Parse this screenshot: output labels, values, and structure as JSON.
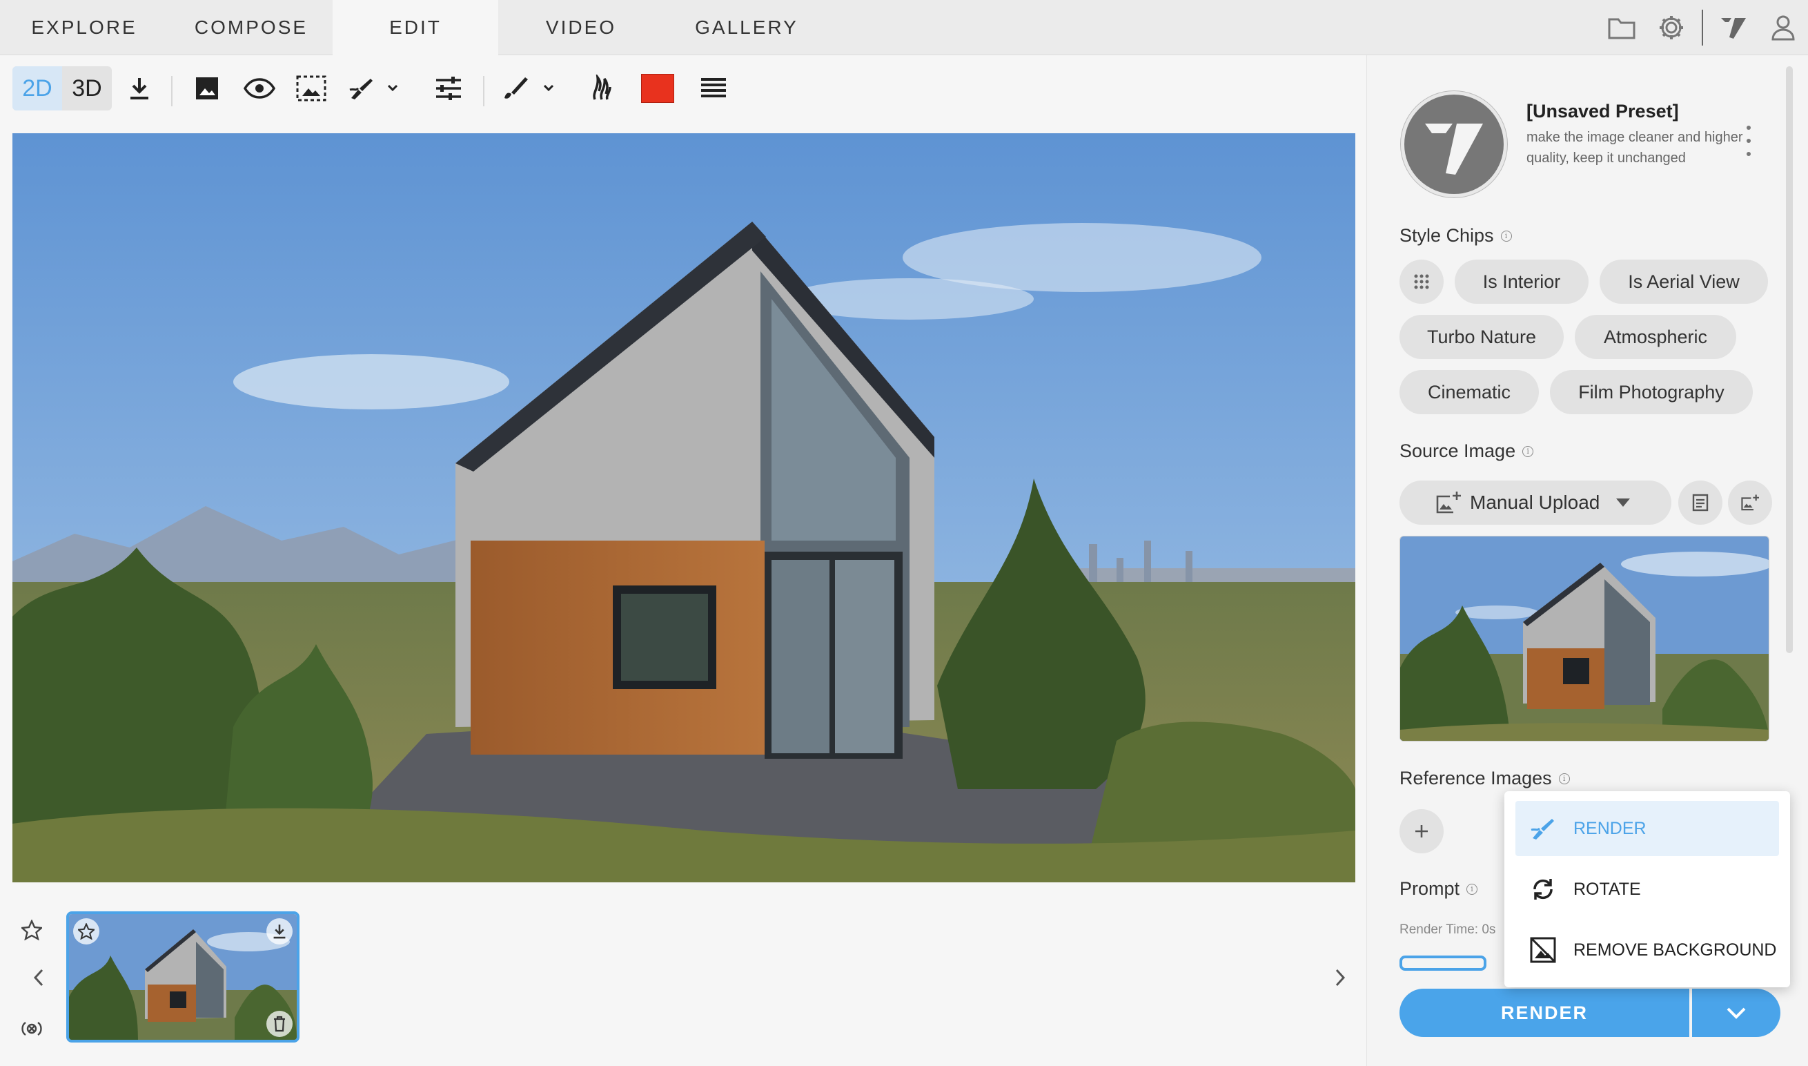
{
  "nav": {
    "tabs": [
      {
        "label": "EXPLORE"
      },
      {
        "label": "COMPOSE"
      },
      {
        "label": "EDIT",
        "active": true
      },
      {
        "label": "VIDEO"
      },
      {
        "label": "GALLERY"
      }
    ],
    "right_icons": [
      "folder-icon",
      "gear-icon",
      "brand-logo-icon",
      "user-icon"
    ]
  },
  "toolbar": {
    "dim_2d": "2D",
    "dim_3d": "3D",
    "active_dim": "2D",
    "icons": [
      "download-icon",
      "image-icon",
      "eye-icon",
      "select-region-icon",
      "brush-mask-icon",
      "sliders-icon",
      "paint-brush-icon",
      "flame-icon",
      "color-swatch",
      "menu-lines-icon"
    ],
    "color": "#e8321e"
  },
  "canvas": {
    "image": "house-on-moor-photo"
  },
  "strip": {
    "icons": [
      "star-icon",
      "chevron-left-icon",
      "no-eye-icon",
      "chevron-right-icon"
    ],
    "thumb_icons": [
      "star-icon",
      "download-icon",
      "trash-icon"
    ]
  },
  "panel": {
    "preset": {
      "title": "[Unsaved Preset]",
      "description": "make the image cleaner and higher quality, keep it unchanged"
    },
    "style_chips": {
      "label": "Style Chips",
      "chips": [
        "Is Interior",
        "Is Aerial View",
        "Turbo Nature",
        "Atmospheric",
        "Cinematic",
        "Film Photography"
      ]
    },
    "source_image": {
      "label": "Source Image",
      "selected": "Manual Upload"
    },
    "reference_images": {
      "label": "Reference Images"
    },
    "prompt": {
      "label": "Prompt"
    },
    "render_time": "Render Time: 0s",
    "render_label": "RENDER"
  },
  "menu": {
    "items": [
      {
        "label": "RENDER",
        "icon": "brush-mask-icon",
        "active": true
      },
      {
        "label": "ROTATE",
        "icon": "rotate-icon"
      },
      {
        "label": "REMOVE BACKGROUND",
        "icon": "remove-background-icon"
      }
    ]
  },
  "colors": {
    "accent": "#4ba3e8",
    "render_button": "#4aa4ea",
    "swatch": "#e8321e"
  }
}
